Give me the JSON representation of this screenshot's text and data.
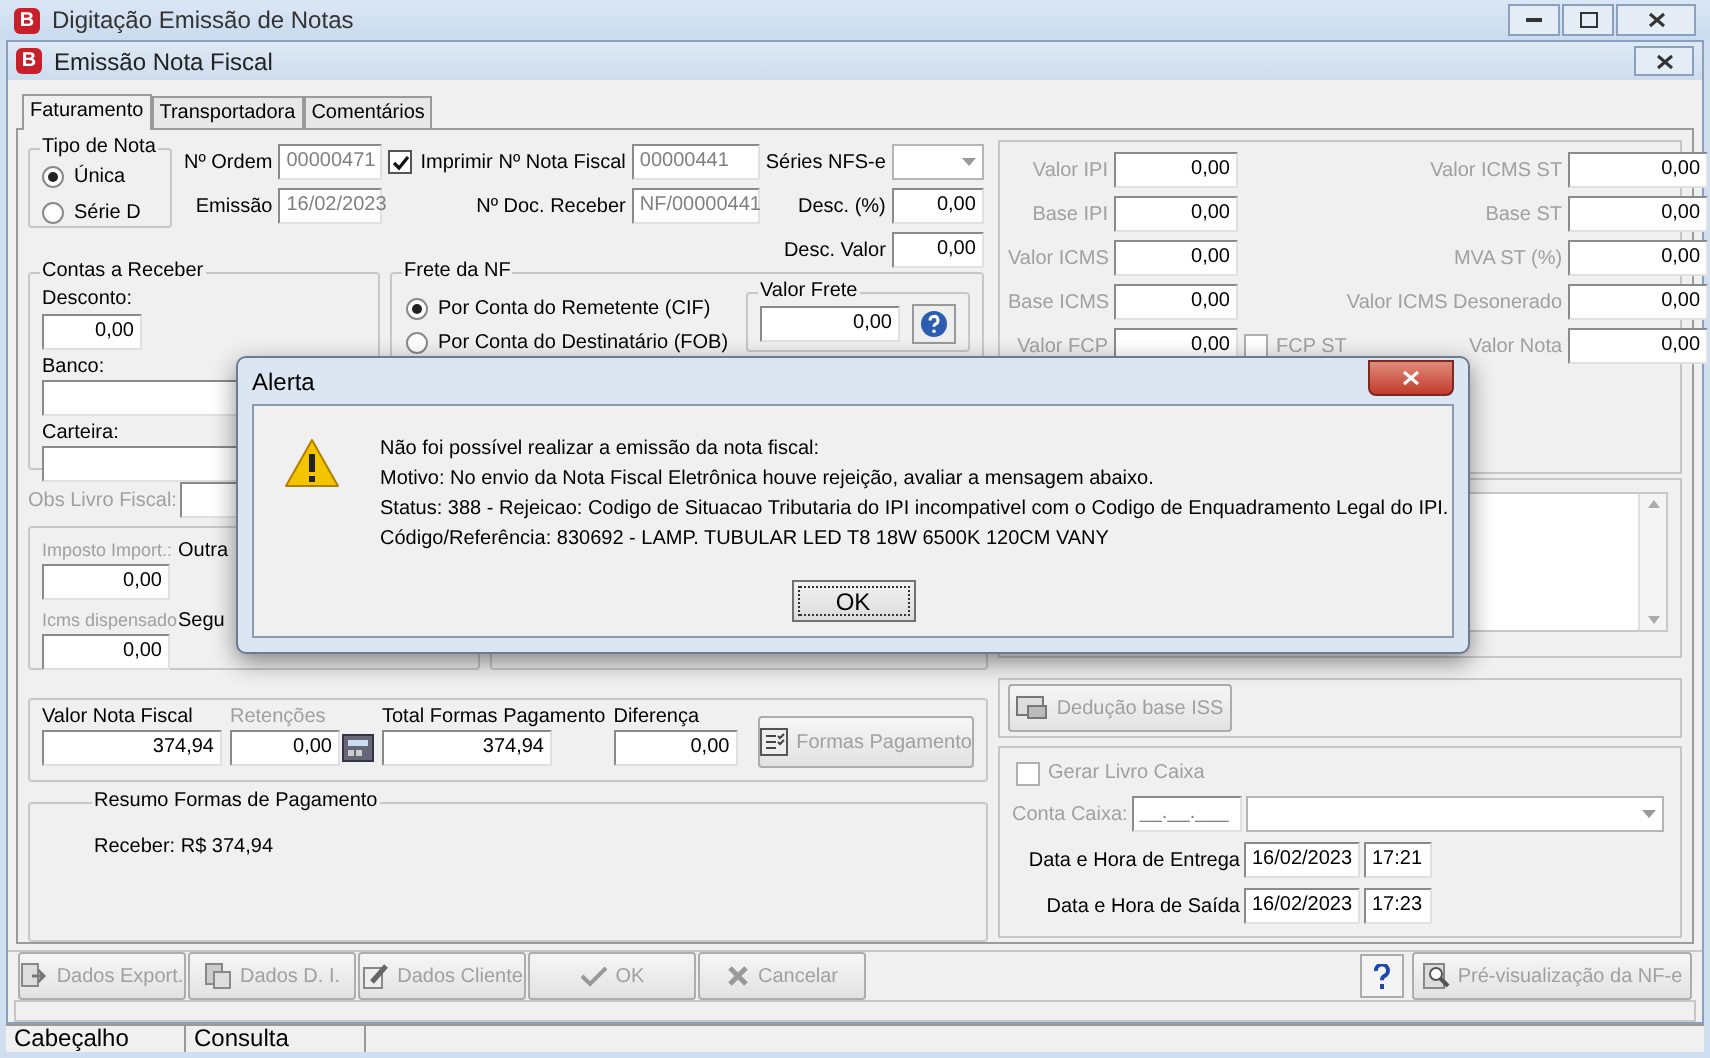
{
  "app_window": {
    "title": "Digitação Emissão de Notas",
    "icon_letter": "B"
  },
  "window": {
    "title": "Emissão Nota Fiscal",
    "icon_letter": "B"
  },
  "tabs": [
    {
      "label": "Faturamento",
      "selected": true
    },
    {
      "label": "Transportadora",
      "selected": false
    },
    {
      "label": "Comentários",
      "selected": false
    }
  ],
  "tipo_nota": {
    "title": "Tipo de Nota",
    "options": [
      {
        "label": "Única",
        "selected": true
      },
      {
        "label": "Série D",
        "selected": false
      }
    ]
  },
  "header": {
    "ordem": {
      "label": "Nº Ordem",
      "value": "00000471",
      "disabled": true
    },
    "imprimir": {
      "label": "Imprimir",
      "checked": true
    },
    "nota_fiscal": {
      "label": "Nº Nota Fiscal",
      "value": "00000441",
      "disabled": true
    },
    "series": {
      "label": "Séries NFS-e"
    },
    "emissao": {
      "label": "Emissão",
      "value": "16/02/2023",
      "disabled": true
    },
    "doc_receber": {
      "label": "Nº Doc. Receber",
      "value": "NF/00000441",
      "disabled": true
    },
    "desc_pct": {
      "label": "Desc. (%)",
      "value": "0,00"
    },
    "desc_valor": {
      "label": "Desc. Valor",
      "value": "0,00"
    }
  },
  "contas": {
    "title": "Contas a Receber",
    "desconto": {
      "label": "Desconto:",
      "value": "0,00"
    },
    "banco": {
      "label": "Banco:"
    },
    "carteira": {
      "label": "Carteira:"
    }
  },
  "frete": {
    "title": "Frete da NF",
    "options": [
      {
        "label": "Por Conta do Remetente (CIF)",
        "selected": true
      },
      {
        "label": "Por Conta do Destinatário (FOB)",
        "selected": false
      }
    ],
    "valor_frete": {
      "title": "Valor Frete",
      "value": "0,00"
    }
  },
  "taxes": {
    "disabled": true,
    "left": [
      {
        "label": "Valor IPI",
        "value": "0,00"
      },
      {
        "label": "Base IPI",
        "value": "0,00"
      },
      {
        "label": "Valor ICMS",
        "value": "0,00"
      },
      {
        "label": "Base ICMS",
        "value": "0,00"
      },
      {
        "label": "Valor FCP",
        "value": "0,00"
      }
    ],
    "fcp_st": {
      "label": "FCP ST",
      "checked": false
    },
    "right": [
      {
        "label": "Valor ICMS ST",
        "value": "0,00"
      },
      {
        "label": "Base ST",
        "value": "0,00"
      },
      {
        "label": "MVA ST (%)",
        "value": "0,00"
      },
      {
        "label": "Valor ICMS Desonerado",
        "value": "0,00"
      },
      {
        "label": "Valor Nota",
        "value": "0,00"
      }
    ]
  },
  "obs": {
    "label": "Obs Livro Fiscal:",
    "disabled": true
  },
  "impostos": [
    {
      "label": "Imposto Import.:",
      "value": "0,00",
      "disabled": true
    },
    {
      "label": "Outra",
      "disabled": false
    },
    {
      "label": "Icms dispensado",
      "value": "0,00",
      "disabled": true
    },
    {
      "label": "Segu",
      "disabled": false
    }
  ],
  "totals": [
    {
      "label": "Valor Nota Fiscal",
      "value": "374,94",
      "disabled": false
    },
    {
      "label": "Retenções",
      "value": "0,00",
      "disabled": true
    },
    {
      "label": "Total Formas Pagamento",
      "value": "374,94",
      "disabled": false
    },
    {
      "label": "Diferença",
      "value": "0,00",
      "disabled": false
    }
  ],
  "formas_button": {
    "label": "Formas Pagamento",
    "disabled": true
  },
  "resumo": {
    "title": "Resumo Formas de Pagamento",
    "text": "Receber: R$ 374,94"
  },
  "deducao_button": {
    "label": "Dedução base ISS",
    "disabled": true
  },
  "caixa": {
    "gerar": {
      "label": "Gerar Livro Caixa",
      "checked": false,
      "disabled": true
    },
    "conta": {
      "label": "Conta Caixa:",
      "value": "__.__.___",
      "disabled": true
    },
    "dates": [
      {
        "label": "Data e Hora de Entrega",
        "date": "16/02/2023",
        "time": "17:21"
      },
      {
        "label": "Data e Hora de Saída",
        "date": "16/02/2023",
        "time": "17:23"
      }
    ]
  },
  "buttons": [
    {
      "label": "Dados Export.",
      "kind": "export",
      "disabled": true
    },
    {
      "label": "Dados D. I.",
      "kind": "import",
      "disabled": true
    },
    {
      "label": "Dados Cliente",
      "kind": "edit",
      "disabled": true
    },
    {
      "label": "OK",
      "kind": "ok",
      "disabled": true
    },
    {
      "label": "Cancelar",
      "kind": "cancel",
      "disabled": true
    }
  ],
  "preview_button": {
    "label": "Pré-visualização da NF-e",
    "disabled": true
  },
  "status_bar": [
    "Cabeçalho",
    "Consulta"
  ],
  "dialog": {
    "title": "Alerta",
    "lines": [
      "Não foi possível realizar a emissão da nota fiscal:",
      "Motivo: No envio da Nota Fiscal Eletrônica houve rejeição, avaliar a mensagem abaixo.",
      "Status: 388 - Rejeicao: Codigo de Situacao Tributaria do IPI incompativel com o Codigo de Enquadramento Legal do IPI.",
      "Código/Referência: 830692 - LAMP. TUBULAR LED T8 18W 6500K 120CM VANY"
    ],
    "button": "OK"
  }
}
